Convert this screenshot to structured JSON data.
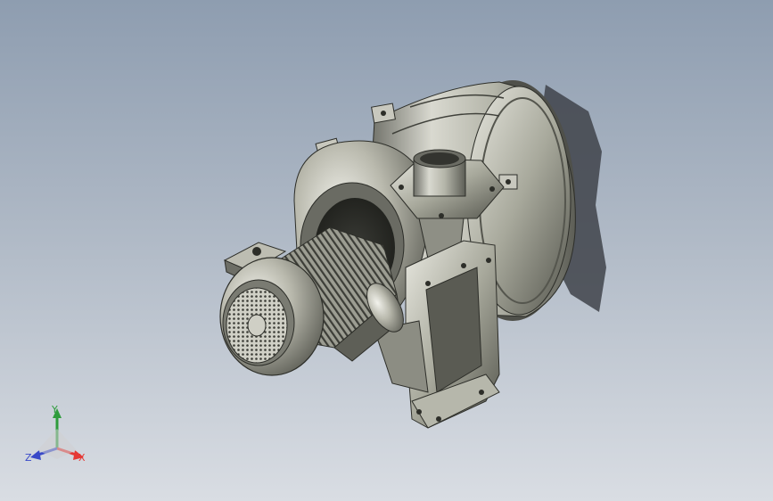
{
  "viewport": {
    "background_top": "#8e9db0",
    "background_bottom": "#d9dde3",
    "model": "centrifugal-blower-assembly"
  },
  "triad": {
    "x_label": "X",
    "y_label": "Y",
    "z_label": "Z",
    "x_color": "#e53935",
    "y_color": "#2e9c3c",
    "z_color": "#3949c8"
  }
}
